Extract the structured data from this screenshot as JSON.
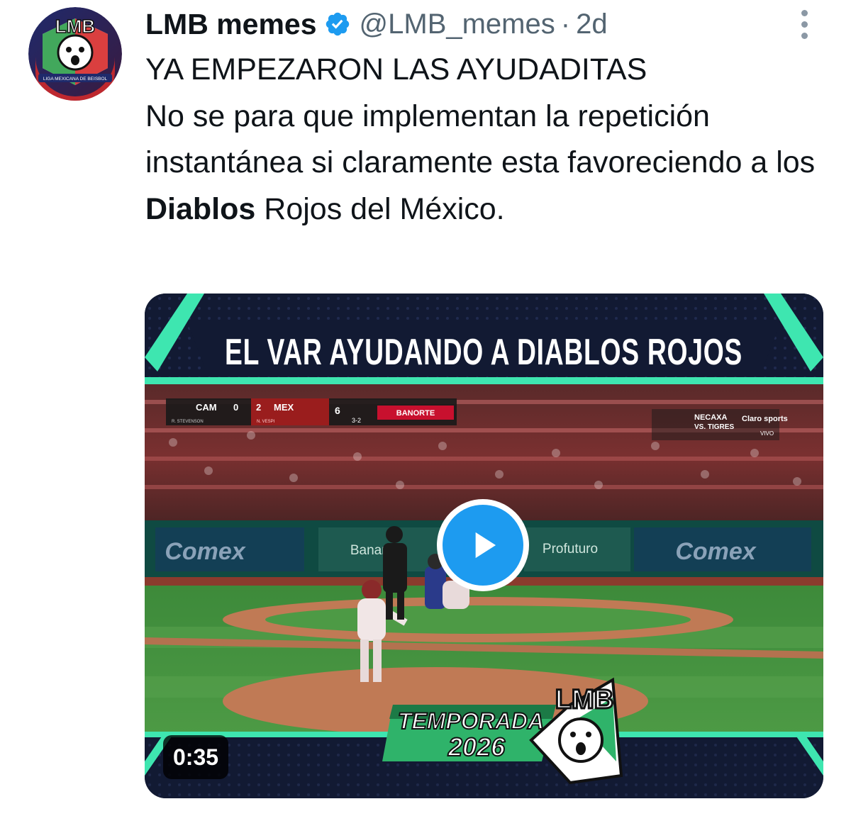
{
  "author": {
    "display_name": "LMB memes",
    "handle": "@LMB_memes",
    "separator": "·",
    "timestamp": "2d",
    "avatar_label": "LMB",
    "avatar_subtext": "LIGA MEXICANA DE BEISBOL"
  },
  "tweet": {
    "line1": "YA EMPEZARON LAS AYUDADITAS",
    "line2_before": "No se para que implementan la repetición instantánea si claramente esta favoreciendo a los ",
    "line2_bold": "Diablos",
    "line2_after": " Rojos del México."
  },
  "media": {
    "banner_text": "EL VAR AYUDANDO A DIABLOS ROJOS",
    "scoreboard": {
      "away": "CAM",
      "away_score": "0",
      "home_score": "2",
      "home": "MEX",
      "inning": "6",
      "count": "3-2",
      "sponsor": "BANORTE",
      "away_pitcher": "R. STEVENSON",
      "home_batter": "N. VESPI"
    },
    "promo": {
      "line1": "NECAXA",
      "line2": "VS. TIGRES",
      "brand": "Claro sports",
      "sub": "VIVO"
    },
    "ads": [
      "Comex",
      "Banamex",
      "Profuturo",
      "Comex"
    ],
    "badge_line1": "TEMPORADA",
    "badge_line2": "2026",
    "badge_logo": "LMB",
    "duration": "0:35"
  },
  "colors": {
    "accent": "#1d9bf0",
    "teal": "#3ee6b0",
    "banner": "#121a33"
  }
}
